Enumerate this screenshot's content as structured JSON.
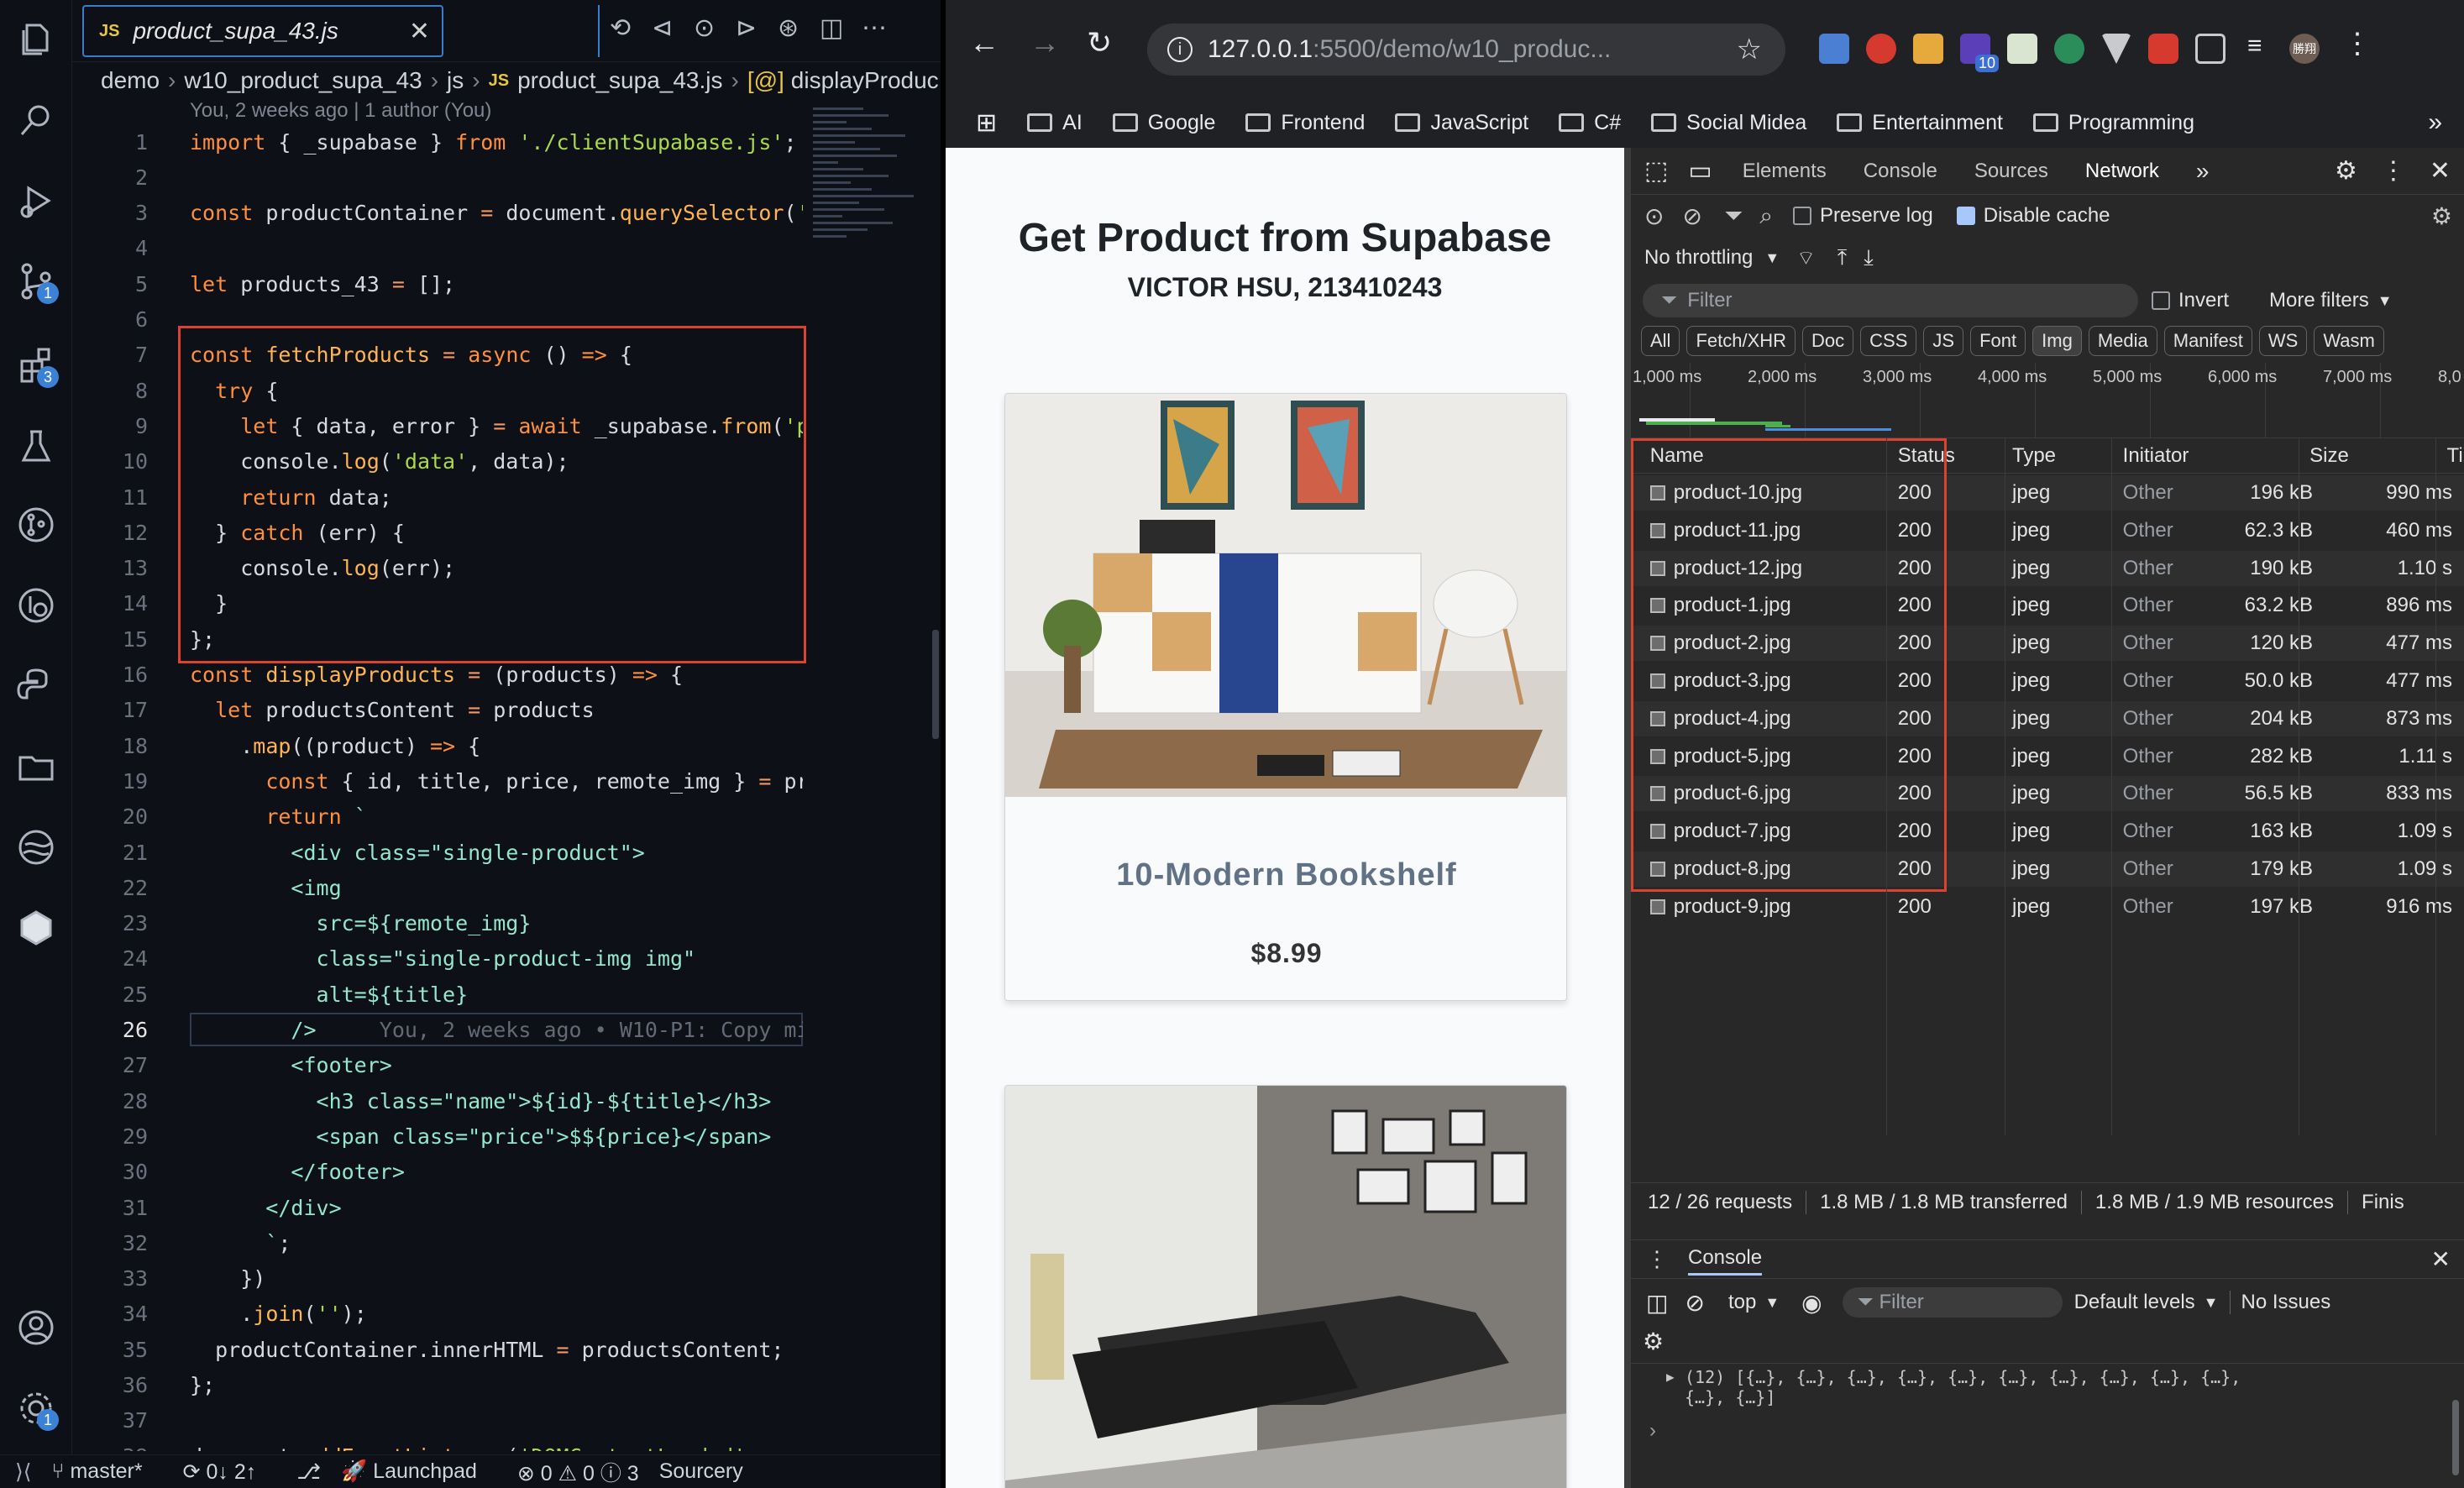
{
  "vscode": {
    "tab": {
      "badge": "JS",
      "title": "product_supa_43.js",
      "close": "✕"
    },
    "breadcrumb": [
      "demo",
      "w10_product_supa_43",
      "js",
      "product_supa_43.js",
      "displayProduc"
    ],
    "breadcrumb_file_badge": "JS",
    "breadcrumb_fn_icon": "[@]",
    "blame_header": "You, 2 weeks ago | 1 author (You)",
    "activity_badges": {
      "source_control": "1",
      "extensions": "3",
      "accounts": "1"
    },
    "lines": [
      {
        "n": "1",
        "html": "<span class='k'>import</span> { <span class='v'>_supabase</span> } <span class='k'>from</span> <span class='s'>'./clientSupabase.js'</span>;"
      },
      {
        "n": "2",
        "html": ""
      },
      {
        "n": "3",
        "html": "<span class='k'>const</span> productContainer <span class='p'>=</span> document.<span class='f'>querySelector</span>(<span class='s'>'.pr</span>"
      },
      {
        "n": "4",
        "html": ""
      },
      {
        "n": "5",
        "html": "<span class='k'>let</span> products_43 <span class='p'>=</span> [];"
      },
      {
        "n": "6",
        "html": ""
      },
      {
        "n": "7",
        "html": "<span class='k'>const</span> <span class='f'>fetchProducts</span> <span class='p'>=</span> <span class='k'>async</span> () <span class='k'>=&gt;</span> {"
      },
      {
        "n": "8",
        "html": "  <span class='k'>try</span> {"
      },
      {
        "n": "9",
        "html": "    <span class='k'>let</span> { data, error } <span class='p'>=</span> <span class='k'>await</span> _supabase.<span class='f'>from</span>(<span class='s'>'prod</span>"
      },
      {
        "n": "10",
        "html": "    console.<span class='f'>log</span>(<span class='s'>'data'</span>, data);"
      },
      {
        "n": "11",
        "html": "    <span class='k'>return</span> data;"
      },
      {
        "n": "12",
        "html": "  } <span class='k'>catch</span> (err) {"
      },
      {
        "n": "13",
        "html": "    console.<span class='f'>log</span>(err);"
      },
      {
        "n": "14",
        "html": "  }"
      },
      {
        "n": "15",
        "html": "};"
      },
      {
        "n": "16",
        "html": "<span class='k'>const</span> <span class='f'>displayProducts</span> <span class='p'>=</span> (products) <span class='k'>=&gt;</span> {"
      },
      {
        "n": "17",
        "html": "  <span class='k'>let</span> productsContent <span class='p'>=</span> products"
      },
      {
        "n": "18",
        "html": "    .<span class='f'>map</span>((product) <span class='k'>=&gt;</span> {"
      },
      {
        "n": "19",
        "html": "      <span class='k'>const</span> { id, title, price, remote_img } <span class='p'>=</span> produ"
      },
      {
        "n": "20",
        "html": "      <span class='k'>return</span> <span class='tl'>`</span>"
      },
      {
        "n": "21",
        "html": "<span class='tl'>        &lt;div class=\"single-product\"&gt;</span>"
      },
      {
        "n": "22",
        "html": "<span class='tl'>        &lt;img</span>"
      },
      {
        "n": "23",
        "html": "<span class='tl'>          src=${remote_img}</span>"
      },
      {
        "n": "24",
        "html": "<span class='tl'>          class=\"single-product-img img\"</span>"
      },
      {
        "n": "25",
        "html": "<span class='tl'>          alt=${title}</span>"
      },
      {
        "n": "26",
        "html": "<span class='tl'>        /&gt;</span>     <span class='c'>You, 2 weeks ago • W10-P1: Copy mid</span>"
      },
      {
        "n": "27",
        "html": "<span class='tl'>        &lt;footer&gt;</span>"
      },
      {
        "n": "28",
        "html": "<span class='tl'>          &lt;h3 class=\"name\"&gt;${id}-${title}&lt;/h3&gt;</span>"
      },
      {
        "n": "29",
        "html": "<span class='tl'>          &lt;span class=\"price\"&gt;$${price}&lt;/span&gt;</span>"
      },
      {
        "n": "30",
        "html": "<span class='tl'>        &lt;/footer&gt;</span>"
      },
      {
        "n": "31",
        "html": "<span class='tl'>      &lt;/div&gt;</span>"
      },
      {
        "n": "32",
        "html": "<span class='tl'>      `</span>;"
      },
      {
        "n": "33",
        "html": "    })"
      },
      {
        "n": "34",
        "html": "    .<span class='f'>join</span>(<span class='s'>''</span>);"
      },
      {
        "n": "35",
        "html": "  productContainer.innerHTML <span class='p'>=</span> productsContent;"
      },
      {
        "n": "36",
        "html": "};"
      },
      {
        "n": "37",
        "html": ""
      },
      {
        "n": "38",
        "html": "document.<span class='f'>addEventListener</span>(<span class='s'>'DOMContentLoaded'</span>, <span class='k'>async</span>"
      }
    ],
    "status": {
      "branch": "master*",
      "sync": "0↓ 2↑",
      "launchpad": "Launchpad",
      "problems": "⊗ 0 ⚠ 0 ⓘ 3",
      "sourcery": "Sourcery"
    }
  },
  "chrome": {
    "url_host": "127.0.0.1",
    "url_rest": ":5500/demo/w10_produc...",
    "ext_badge": "10",
    "profile_name": "勝翔",
    "bookmarks": [
      "AI",
      "Google",
      "Frontend",
      "JavaScript",
      "C#",
      "Social Midea",
      "Entertainment",
      "Programming"
    ],
    "page": {
      "title": "Get Product from Supabase",
      "subtitle": "VICTOR HSU, 213410243",
      "card1": {
        "name": "10-Modern Bookshelf",
        "price": "$8.99"
      }
    },
    "devtools": {
      "tabs": [
        "Elements",
        "Console",
        "Sources",
        "Network"
      ],
      "active_tab": "Network",
      "preserve_log": "Preserve log",
      "disable_cache": "Disable cache",
      "throttling": "No throttling",
      "filter_placeholder": "Filter",
      "invert": "Invert",
      "more_filters": "More filters",
      "type_filters": [
        "All",
        "Fetch/XHR",
        "Doc",
        "CSS",
        "JS",
        "Font",
        "Img",
        "Media",
        "Manifest",
        "WS",
        "Wasm"
      ],
      "active_type": "Img",
      "timeline_ticks": [
        "1,000 ms",
        "2,000 ms",
        "3,000 ms",
        "4,000 ms",
        "5,000 ms",
        "6,000 ms",
        "7,000 ms",
        "8,0"
      ],
      "columns": [
        "Name",
        "Status",
        "Type",
        "Initiator",
        "Size",
        "Time"
      ],
      "rows": [
        {
          "name": "product-10.jpg",
          "status": "200",
          "type": "jpeg",
          "initiator": "Other",
          "size": "196 kB",
          "time": "990 ms"
        },
        {
          "name": "product-11.jpg",
          "status": "200",
          "type": "jpeg",
          "initiator": "Other",
          "size": "62.3 kB",
          "time": "460 ms"
        },
        {
          "name": "product-12.jpg",
          "status": "200",
          "type": "jpeg",
          "initiator": "Other",
          "size": "190 kB",
          "time": "1.10 s"
        },
        {
          "name": "product-1.jpg",
          "status": "200",
          "type": "jpeg",
          "initiator": "Other",
          "size": "63.2 kB",
          "time": "896 ms"
        },
        {
          "name": "product-2.jpg",
          "status": "200",
          "type": "jpeg",
          "initiator": "Other",
          "size": "120 kB",
          "time": "477 ms"
        },
        {
          "name": "product-3.jpg",
          "status": "200",
          "type": "jpeg",
          "initiator": "Other",
          "size": "50.0 kB",
          "time": "477 ms"
        },
        {
          "name": "product-4.jpg",
          "status": "200",
          "type": "jpeg",
          "initiator": "Other",
          "size": "204 kB",
          "time": "873 ms"
        },
        {
          "name": "product-5.jpg",
          "status": "200",
          "type": "jpeg",
          "initiator": "Other",
          "size": "282 kB",
          "time": "1.11 s"
        },
        {
          "name": "product-6.jpg",
          "status": "200",
          "type": "jpeg",
          "initiator": "Other",
          "size": "56.5 kB",
          "time": "833 ms"
        },
        {
          "name": "product-7.jpg",
          "status": "200",
          "type": "jpeg",
          "initiator": "Other",
          "size": "163 kB",
          "time": "1.09 s"
        },
        {
          "name": "product-8.jpg",
          "status": "200",
          "type": "jpeg",
          "initiator": "Other",
          "size": "179 kB",
          "time": "1.09 s"
        },
        {
          "name": "product-9.jpg",
          "status": "200",
          "type": "jpeg",
          "initiator": "Other",
          "size": "197 kB",
          "time": "916 ms"
        }
      ],
      "summary": [
        "12 / 26 requests",
        "1.8 MB / 1.8 MB transferred",
        "1.8 MB / 1.9 MB resources",
        "Finis"
      ],
      "console": {
        "title": "Console",
        "context": "top",
        "filter_placeholder": "Filter",
        "levels": "Default levels",
        "issues": "No Issues",
        "log_line1": "(12) [{…}, {…}, {…}, {…}, {…}, {…}, {…}, {…}, {…}, {…},",
        "log_line2": "{…}, {…}]"
      }
    }
  }
}
